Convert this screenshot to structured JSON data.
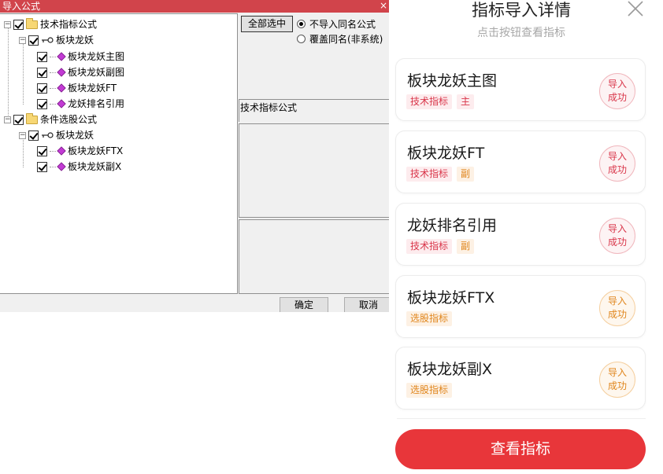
{
  "dialog": {
    "title": "导入公式",
    "close_glyph": "×",
    "tree": {
      "groups": [
        {
          "label": "技术指标公式",
          "checked": true,
          "subgroup": {
            "label": "板块龙妖",
            "items": [
              "板块龙妖主图",
              "板块龙妖副图",
              "板块龙妖FT",
              "龙妖排名引用"
            ]
          }
        },
        {
          "label": "条件选股公式",
          "checked": true,
          "subgroup": {
            "label": "板块龙妖",
            "items": [
              "板块龙妖FTX",
              "板块龙妖副X"
            ]
          }
        }
      ]
    },
    "select_all_label": "全部选中",
    "options": [
      {
        "label": "不导入同名公式",
        "selected": true
      },
      {
        "label": "覆盖同名(非系统)",
        "selected": false
      }
    ],
    "section_label": "技术指标公式",
    "ok_label": "确定",
    "cancel_label": "取消"
  },
  "mobile": {
    "title": "指标导入详情",
    "subtitle": "点击按钮查看指标",
    "cards": [
      {
        "name": "板块龙妖主图",
        "tags": [
          {
            "text": "技术指标",
            "tone": "red"
          },
          {
            "text": "主",
            "tone": "red"
          }
        ],
        "status_line1": "导入",
        "status_line2": "成功",
        "tone": "red"
      },
      {
        "name": "板块龙妖FT",
        "tags": [
          {
            "text": "技术指标",
            "tone": "red"
          },
          {
            "text": "副",
            "tone": "orange"
          }
        ],
        "status_line1": "导入",
        "status_line2": "成功",
        "tone": "red"
      },
      {
        "name": "龙妖排名引用",
        "tags": [
          {
            "text": "技术指标",
            "tone": "red"
          },
          {
            "text": "副",
            "tone": "orange"
          }
        ],
        "status_line1": "导入",
        "status_line2": "成功",
        "tone": "red"
      },
      {
        "name": "板块龙妖FTX",
        "tags": [
          {
            "text": "选股指标",
            "tone": "orange"
          }
        ],
        "status_line1": "导入",
        "status_line2": "成功",
        "tone": "orange"
      },
      {
        "name": "板块龙妖副X",
        "tags": [
          {
            "text": "选股指标",
            "tone": "orange"
          }
        ],
        "status_line1": "导入",
        "status_line2": "成功",
        "tone": "orange"
      }
    ],
    "cta_label": "查看指标"
  },
  "colors": {
    "titlebar": "#d1444b",
    "accent_red": "#e8363a",
    "tag_red": "#d9364a",
    "tag_orange": "#e0861d"
  }
}
